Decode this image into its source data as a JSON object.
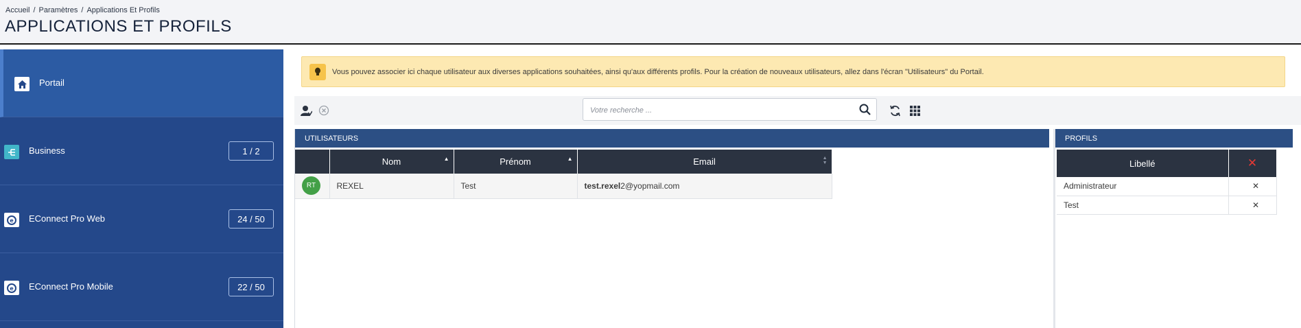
{
  "breadcrumb": [
    "Accueil",
    "Paramètres",
    "Applications Et Profils"
  ],
  "page_title": "APPLICATIONS ET PROFILS",
  "sidebar": {
    "items": [
      {
        "label": "Portail",
        "count": "",
        "icon": "home-icon",
        "active": true
      },
      {
        "label": "Business",
        "count": "1 / 2",
        "icon": "business-icon",
        "active": false
      },
      {
        "label": "EConnect Pro Web",
        "count": "24 / 50",
        "icon": "econnect-icon",
        "active": false
      },
      {
        "label": "EConnect Pro Mobile",
        "count": "22 / 50",
        "icon": "econnect-icon",
        "active": false
      }
    ]
  },
  "info": {
    "text": "Vous pouvez associer ici chaque utilisateur aux diverses applications souhaitées, ainsi qu'aux différents profils. Pour la création de nouveaux utilisateurs, allez dans l'écran \"Utilisateurs\" du Portail."
  },
  "toolbar": {
    "search_placeholder": "Votre recherche ..."
  },
  "users": {
    "title": "UTILISATEURS",
    "columns": [
      "Nom",
      "Prénom",
      "Email"
    ],
    "rows": [
      {
        "initials": "RT",
        "nom": "REXEL",
        "prenom": "Test",
        "email_bold": "test.rexel",
        "email_rest": "2@yopmail.com"
      }
    ]
  },
  "profiles": {
    "title": "PROFILS",
    "column": "Libellé",
    "rows": [
      "Administrateur",
      "Test"
    ]
  },
  "colors": {
    "sidebar": "#24488a",
    "sidebar_active": "#2c5ba3",
    "panel_header": "#2c4f84",
    "table_header": "#2b3341",
    "banner": "#fde9b2",
    "avatar": "#43a047",
    "delete": "#e53935"
  }
}
